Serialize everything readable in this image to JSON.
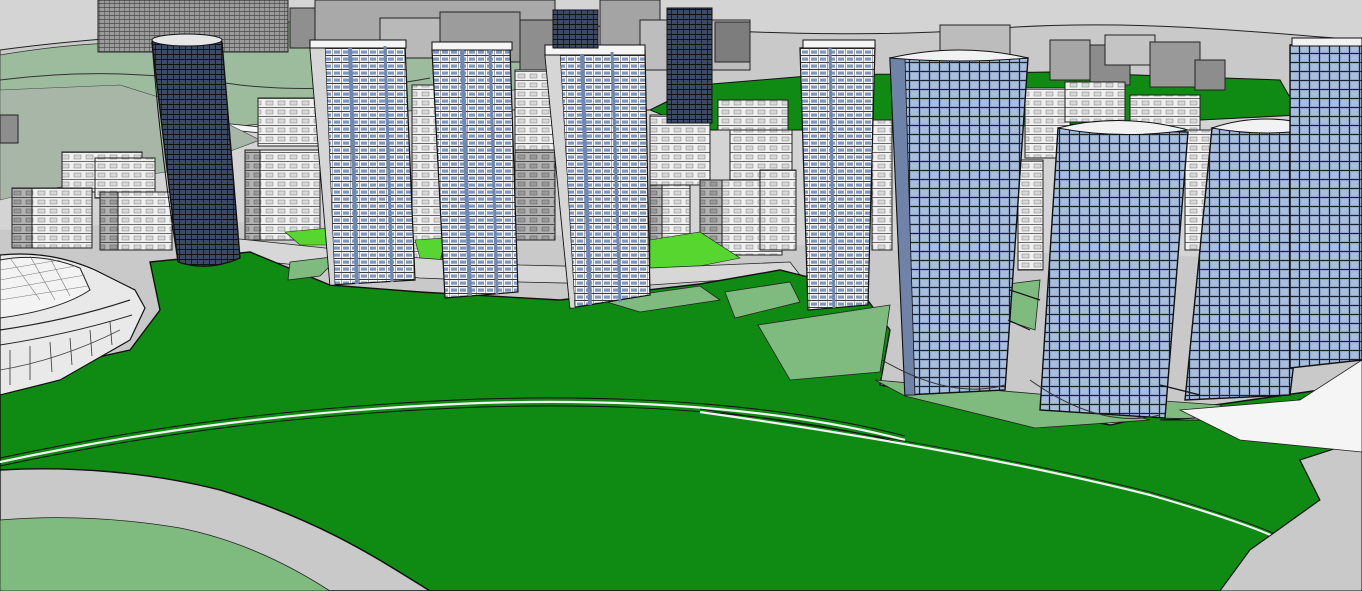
{
  "scene": {
    "colors": {
      "sky": "#d4d4d4",
      "ground_gray": "#c6c6c6",
      "grass": "#0f8a12",
      "grass_dark": "#0c7a10",
      "pale_green": "#7fba7f",
      "lime": "#58d630",
      "wall_white": "#f2f2f2",
      "wall_gray": "#b9b9b9",
      "glass_blue": "#8fa6c9",
      "glass_dark": "#2d3a55",
      "line": "#1a1a1a",
      "road_white": "#f7f7f7"
    }
  }
}
